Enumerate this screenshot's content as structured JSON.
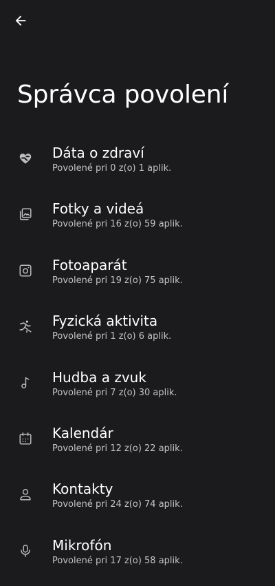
{
  "header": {
    "back_icon": "arrow-left-icon",
    "title": "Správca povolení"
  },
  "colors": {
    "background": "#1b1b1d",
    "text_primary": "#ffffff",
    "text_secondary": "#c4c4c7",
    "icon": "#bdbdc2"
  },
  "permissions": [
    {
      "icon": "health-heart-icon",
      "name": "Dáta o zdraví",
      "desc": "Povolené pri 0 z(o) 1 aplik."
    },
    {
      "icon": "photos-icon",
      "name": "Fotky a videá",
      "desc": "Povolené pri 16 z(o) 59 aplik."
    },
    {
      "icon": "camera-icon",
      "name": "Fotoaparát",
      "desc": "Povolené pri 19 z(o) 75 aplik."
    },
    {
      "icon": "activity-icon",
      "name": "Fyzická aktivita",
      "desc": "Povolené pri 1 z(o) 6 aplik."
    },
    {
      "icon": "music-note-icon",
      "name": "Hudba a zvuk",
      "desc": "Povolené pri 7 z(o) 30 aplik."
    },
    {
      "icon": "calendar-icon",
      "name": "Kalendár",
      "desc": "Povolené pri 12 z(o) 22 aplik."
    },
    {
      "icon": "person-icon",
      "name": "Kontakty",
      "desc": "Povolené pri 24 z(o) 74 aplik."
    },
    {
      "icon": "microphone-icon",
      "name": "Mikrofón",
      "desc": "Povolené pri 17 z(o) 58 aplik."
    }
  ]
}
